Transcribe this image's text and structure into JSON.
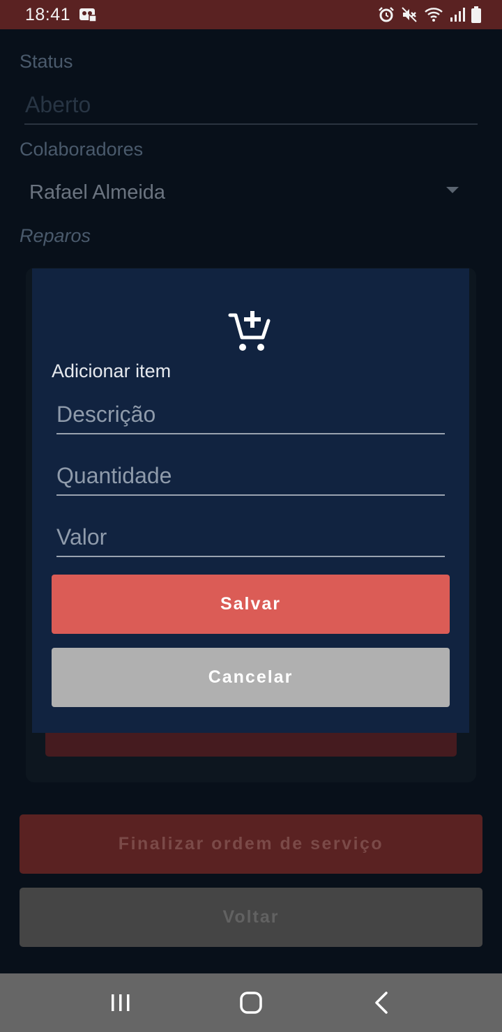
{
  "status_bar": {
    "time": "18:41"
  },
  "form": {
    "status_label": "Status",
    "status_value": "Aberto",
    "collaborators_label": "Colaboradores",
    "collaborator_selected": "Rafael Almeida",
    "repairs_label": "Reparos"
  },
  "buttons": {
    "finalize_label": "Finalizar ordem de serviço",
    "back_label": "Voltar"
  },
  "dialog": {
    "icon": "add-to-cart-icon",
    "title": "Adicionar item",
    "description_placeholder": "Descrição",
    "quantity_placeholder": "Quantidade",
    "value_placeholder": "Valor",
    "save_label": "Salvar",
    "cancel_label": "Cancelar"
  },
  "colors": {
    "status_bar": "#5a2222",
    "dialog_background": "#112340",
    "save_button": "#db5c56",
    "cancel_button": "#b0b0b0"
  }
}
